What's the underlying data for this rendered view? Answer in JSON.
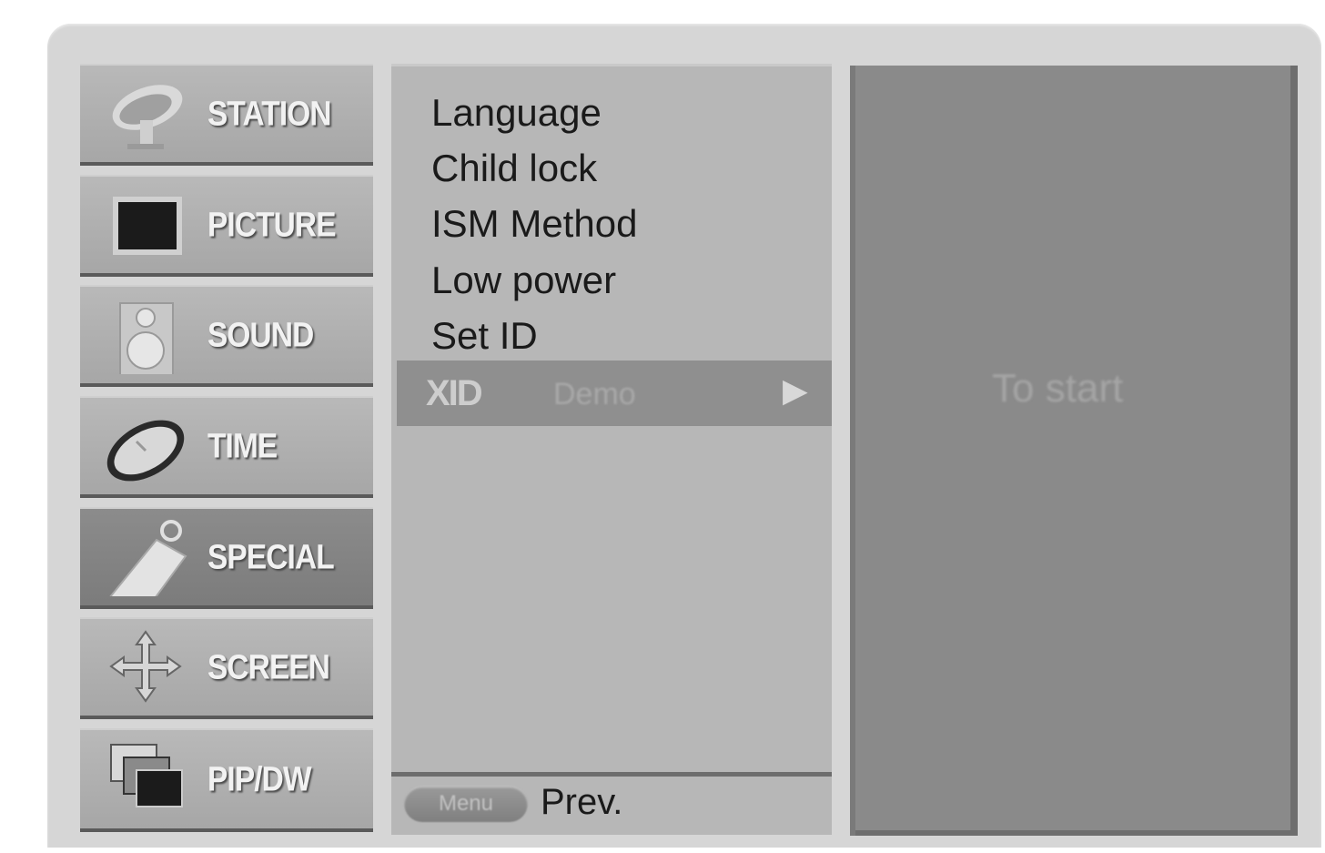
{
  "categories": [
    {
      "label": "STATION",
      "icon": "satellite-dish-icon"
    },
    {
      "label": "PICTURE",
      "icon": "screen-icon"
    },
    {
      "label": "SOUND",
      "icon": "speaker-icon"
    },
    {
      "label": "TIME",
      "icon": "clock-icon"
    },
    {
      "label": "SPECIAL",
      "icon": "tag-icon",
      "selected": true
    },
    {
      "label": "SCREEN",
      "icon": "move-arrows-icon"
    },
    {
      "label": "PIP/DW",
      "icon": "pip-windows-icon"
    }
  ],
  "submenu": {
    "items": [
      "Language",
      "Child lock",
      "ISM Method",
      "Low power",
      "Set ID"
    ],
    "highlighted": {
      "icon_text": "XID",
      "label": "Demo",
      "arrow": "▶"
    }
  },
  "footer": {
    "key_label": "Menu",
    "prev_label": "Prev."
  },
  "right_panel": {
    "text": "To start"
  }
}
